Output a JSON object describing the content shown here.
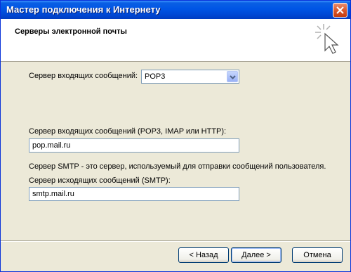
{
  "window": {
    "title": "Мастер подключения к Интернету"
  },
  "header": {
    "title": "Серверы электронной почты"
  },
  "form": {
    "incoming_type_label": "Сервер входящих сообщений:",
    "incoming_type_value": "POP3",
    "incoming_server_label": "Сервер входящих сообщений (POP3, IMAP или HTTP):",
    "incoming_server_value": "pop.mail.ru",
    "smtp_description": "Сервер SMTP - это сервер, используемый для отправки сообщений  пользователя.",
    "outgoing_server_label": "Сервер исходящих сообщений (SMTP):",
    "outgoing_server_value": "smtp.mail.ru"
  },
  "buttons": {
    "back": "< Назад",
    "next": "Далее >",
    "cancel": "Отмена"
  },
  "icons": {
    "close": "close-icon",
    "wizard": "wizard-cursor-icon",
    "dropdown": "chevron-down-icon"
  },
  "colors": {
    "titlebar": "#0055e5",
    "dialog": "#ece9d8",
    "close": "#d9582d"
  }
}
